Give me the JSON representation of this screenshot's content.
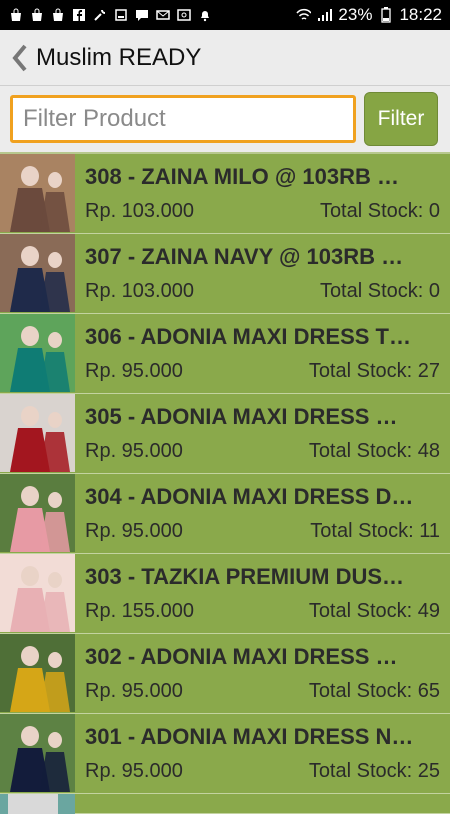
{
  "status": {
    "battery": "23%",
    "time": "18:22"
  },
  "header": {
    "title": "Muslim READY"
  },
  "filter": {
    "placeholder": "Filter Product",
    "button": "Filter"
  },
  "products": [
    {
      "name": "308 - ZAINA MILO @ 103RB …",
      "price": "Rp. 103.000",
      "stock": "Total Stock: 0",
      "colors": [
        "#6b4a3d",
        "#a98362"
      ]
    },
    {
      "name": "307 - ZAINA NAVY @ 103RB …",
      "price": "Rp. 103.000",
      "stock": "Total Stock: 0",
      "colors": [
        "#1f2a4a",
        "#8a6b57"
      ]
    },
    {
      "name": "306 - ADONIA MAXI DRESS T…",
      "price": "Rp. 95.000",
      "stock": "Total Stock: 27",
      "colors": [
        "#0f7c74",
        "#5ea45b"
      ]
    },
    {
      "name": "305 - ADONIA MAXI DRESS …",
      "price": "Rp. 95.000",
      "stock": "Total Stock: 48",
      "colors": [
        "#a3161f",
        "#d9d3cf"
      ]
    },
    {
      "name": "304 - ADONIA MAXI DRESS D…",
      "price": "Rp. 95.000",
      "stock": "Total Stock: 11",
      "colors": [
        "#e79aa4",
        "#5a7d3f"
      ]
    },
    {
      "name": "303 - TAZKIA PREMIUM DUS…",
      "price": "Rp. 155.000",
      "stock": "Total Stock: 49",
      "colors": [
        "#e8b0b4",
        "#f2dcd6"
      ]
    },
    {
      "name": "302 - ADONIA MAXI DRESS …",
      "price": "Rp. 95.000",
      "stock": "Total Stock: 65",
      "colors": [
        "#d5a617",
        "#4f6f37"
      ]
    },
    {
      "name": "301 - ADONIA MAXI DRESS N…",
      "price": "Rp. 95.000",
      "stock": "Total Stock: 25",
      "colors": [
        "#131c3b",
        "#5d8244"
      ]
    }
  ]
}
